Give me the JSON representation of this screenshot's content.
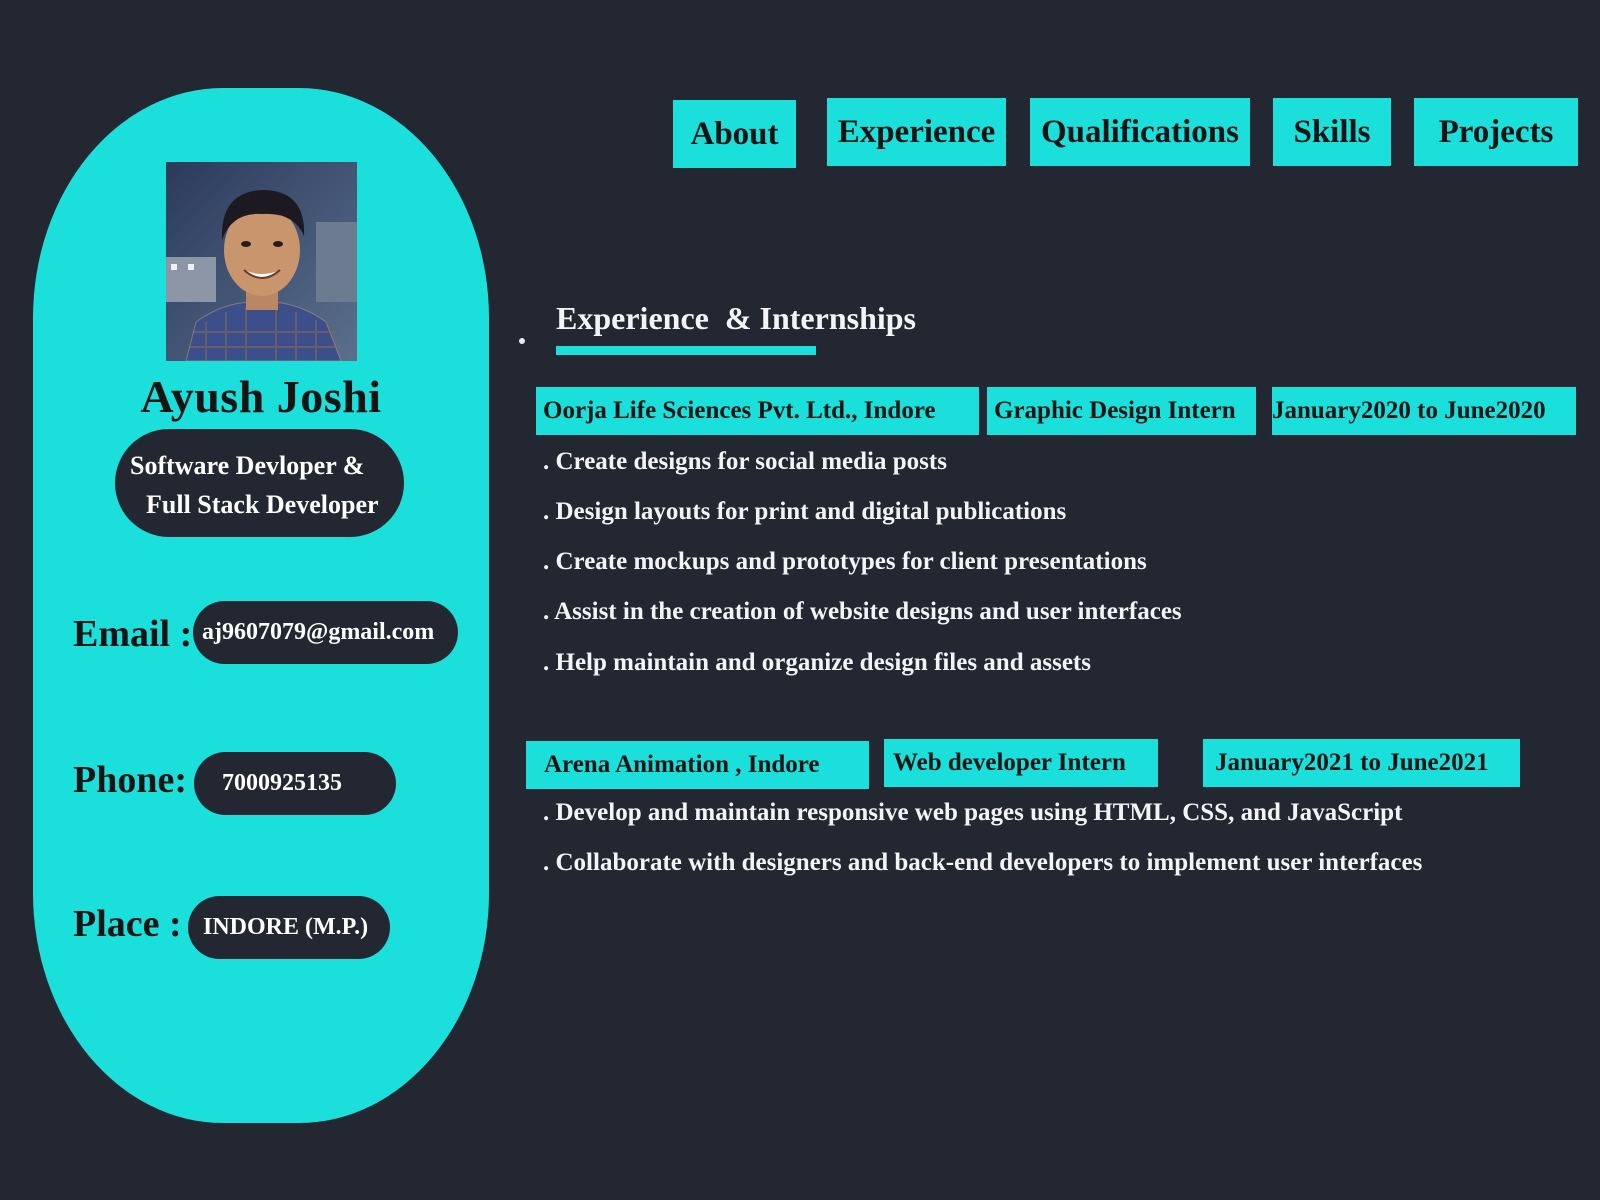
{
  "colors": {
    "background": "#222731",
    "accent": "#1bdfda",
    "text_light": "#ffffff",
    "text_dark": "#141414"
  },
  "nav": {
    "tabs": [
      {
        "label": "About"
      },
      {
        "label": "Experience"
      },
      {
        "label": "Qualifications"
      },
      {
        "label": "Skills"
      },
      {
        "label": "Projects"
      }
    ]
  },
  "profile": {
    "name": "Ayush Joshi",
    "title_line_1": "Software Devloper &",
    "title_line_2": "Full Stack Developer",
    "email_label": "Email :",
    "email": "aj9607079@gmail.com",
    "phone_label": "Phone:",
    "phone": "7000925135",
    "place_label": "Place :",
    "place": "INDORE (M.P.)"
  },
  "experience": {
    "heading": "Experience  & Internships",
    "jobs": [
      {
        "company": "Oorja Life Sciences Pvt. Ltd., Indore",
        "role": "Graphic Design Intern",
        "period": "January2020 to June2020",
        "duties": [
          ". Create designs for social media posts",
          ". Design layouts for print and digital publications",
          ". Create mockups and prototypes for client presentations",
          ". Assist in the creation of website designs and user interfaces",
          ". Help maintain and organize design files and assets"
        ]
      },
      {
        "company": "Arena Animation , Indore",
        "role": "Web developer Intern",
        "period": "January2021 to June2021",
        "duties": [
          ". Develop and maintain responsive web pages using HTML, CSS, and JavaScript",
          ". Collaborate with designers and back-end developers to implement user interfaces"
        ]
      }
    ]
  }
}
